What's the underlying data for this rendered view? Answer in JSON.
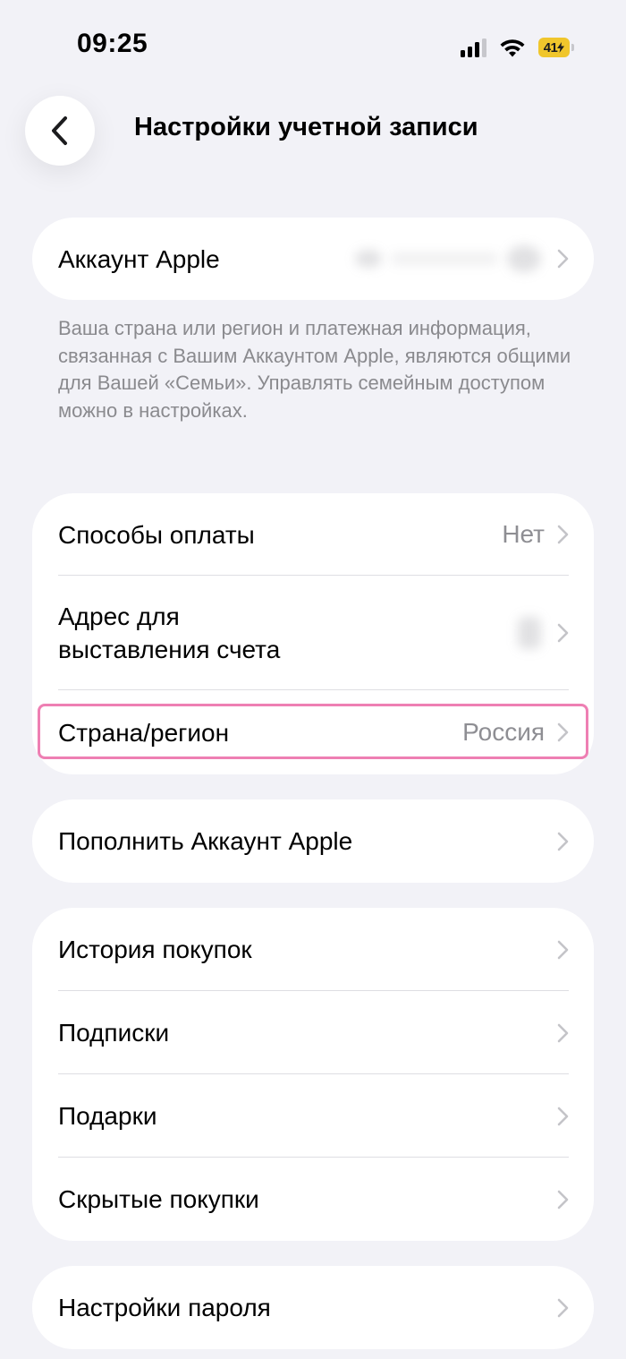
{
  "status_bar": {
    "time": "09:25",
    "battery_level": "41",
    "icons": [
      "signal-icon",
      "wifi-icon",
      "battery-charging-icon"
    ],
    "battery_color": "#f0c62c"
  },
  "nav": {
    "back_icon": "chevron-left-icon",
    "title": "Настройки учетной записи"
  },
  "apple_account": {
    "label": "Аккаунт Apple",
    "value_state": "blurred"
  },
  "footnote": "Ваша страна или регион и платежная информация, связанная с Вашим Аккаунтом Apple, являются общими для Вашей «Семьи». Управлять семейным доступом можно в настройках.",
  "billing_group": {
    "payment_methods": {
      "label": "Способы оплаты",
      "value": "Нет"
    },
    "billing_address": {
      "label_line1": "Адрес для",
      "label_line2": "выставления счета",
      "value_state": "blurred"
    },
    "country_region": {
      "label": "Страна/регион",
      "value": "Россия",
      "highlighted": true,
      "highlight_color": "#ee7fb3"
    }
  },
  "top_up": {
    "label": "Пополнить Аккаунт Apple"
  },
  "purchases_group": {
    "items": [
      {
        "label": "История покупок"
      },
      {
        "label": "Подписки"
      },
      {
        "label": "Подарки"
      },
      {
        "label": "Скрытые покупки"
      }
    ]
  },
  "password_settings": {
    "label": "Настройки пароля"
  },
  "colors": {
    "background": "#f2f2f7",
    "card": "#ffffff",
    "secondary_text": "#8e8e93",
    "chevron": "#c4c4c8"
  }
}
